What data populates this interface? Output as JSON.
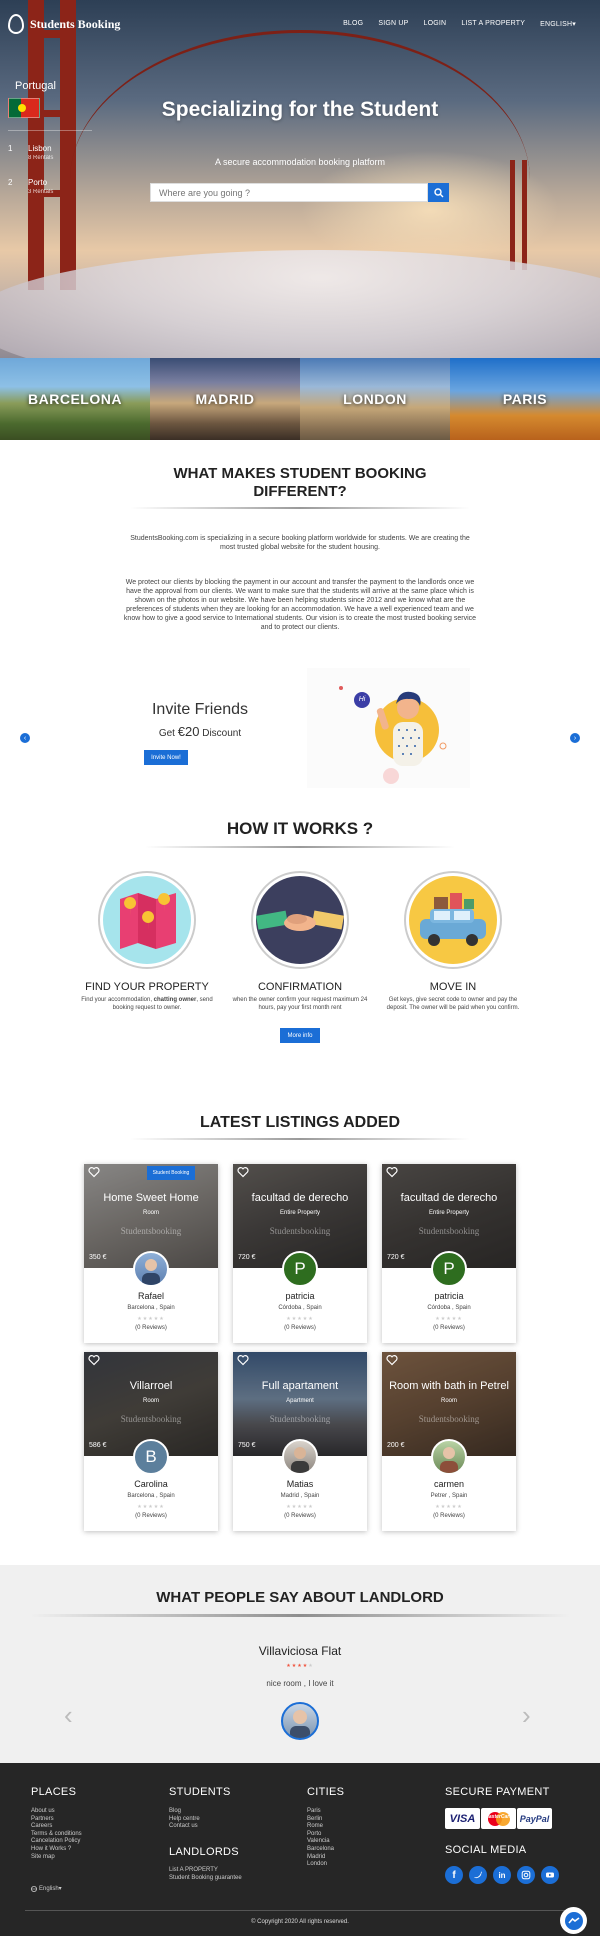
{
  "brand": {
    "name": "Students Booking"
  },
  "nav": {
    "items": [
      "BLOG",
      "SIGN UP",
      "LOGIN",
      "LIST A PROPERTY",
      "ENGLISH▾"
    ]
  },
  "side_panel": {
    "country": "Portugal",
    "cities": [
      {
        "num": "1",
        "name": "Lisbon",
        "count": "8 Rentals"
      },
      {
        "num": "2",
        "name": "Porto",
        "count": "3 Rentals"
      }
    ]
  },
  "hero": {
    "title": "Specializing for the Student",
    "subtitle": "A secure accommodation booking platform",
    "search_placeholder": "Where are you going ?"
  },
  "city_strip": [
    "BARCELONA",
    "MADRID",
    "LONDON",
    "PARIS"
  ],
  "different": {
    "title": "WHAT MAKES STUDENT BOOKING DIFFERENT?",
    "p1": "StudentsBooking.com is specializing in a secure booking platform worldwide for students. We are creating the most trusted global website for the student housing.",
    "p2": "We protect our clients by blocking the payment in our account and transfer the payment to the landlords once we have the approval from our clients. We want to make sure that the students will arrive at the same place which is shown on the photos in our website. We have been helping students since 2012 and we know what are the preferences of students when they are looking for an accommodation. We have a well experienced team and we know how to give a good service to International students. Our vision is to create the most trusted booking service and to protect our clients."
  },
  "invite": {
    "title": "Invite Friends",
    "get": "Get",
    "amount": "€20",
    "discount": "Discount",
    "button": "Invite Now!",
    "bubble": "Hi"
  },
  "how": {
    "title": "HOW IT WORKS ?",
    "steps": [
      {
        "title": "FIND YOUR PROPERTY",
        "text_a": "Find your accommodation, ",
        "text_bold": "chatting owner",
        "text_b": ", send booking request to owner."
      },
      {
        "title": "CONFIRMATION",
        "text": "when the owner confirm your request maximum 24 hours, pay your first month rent"
      },
      {
        "title": "MOVE IN",
        "text": "Get keys, give secret code to owner and pay the deposit. The owner will be paid when you confirm."
      }
    ],
    "button": "More info"
  },
  "listings": {
    "title": "LATEST LISTINGS ADDED",
    "badge": "Student Booking",
    "watermark": "Studentsbooking",
    "items": [
      {
        "title": "Home Sweet Home",
        "type": "Room",
        "price": "350 €",
        "name": "Rafael",
        "location": "Barcelona , Spain",
        "reviews": "(0 Reviews)",
        "stars": "★★★★★"
      },
      {
        "title": "facultad de derecho",
        "type": "Entire Property",
        "price": "720 €",
        "name": "patricia",
        "location": "Córdoba , Spain",
        "reviews": "(0 Reviews)",
        "stars": "★★★★★",
        "initial": "P"
      },
      {
        "title": "facultad de derecho",
        "type": "Entire Property",
        "price": "720 €",
        "name": "patricia",
        "location": "Córdoba , Spain",
        "reviews": "(0 Reviews)",
        "stars": "★★★★★",
        "initial": "P"
      },
      {
        "title": "Villarroel",
        "type": "Room",
        "price": "586 €",
        "name": "Carolina",
        "location": "Barcelona , Spain",
        "reviews": "(0 Reviews)",
        "stars": "★★★★★",
        "initial": "B"
      },
      {
        "title": "Full apartament",
        "type": "Apartment",
        "price": "750 €",
        "name": "Matias",
        "location": "Madrid , Spain",
        "reviews": "(0 Reviews)",
        "stars": "★★★★★"
      },
      {
        "title": "Room with bath in Petrel",
        "type": "Room",
        "price": "200 €",
        "name": "carmen",
        "location": "Petrer , Spain",
        "reviews": "(0 Reviews)",
        "stars": "★★★★★"
      }
    ]
  },
  "testimonials": {
    "title": "WHAT PEOPLE SAY ABOUT LANDLORD",
    "property": "Villaviciosa Flat",
    "stars": "★★★★★",
    "rating": 4,
    "comment": "nice room , I love it",
    "prev": "‹",
    "next": "›"
  },
  "footer": {
    "places": {
      "title": "PLACES",
      "links": [
        "About us",
        "Partners",
        "Careers",
        "Terms & conditions",
        "Cancelation Policy",
        "How it Works ?",
        "Site map"
      ],
      "language": "English▾"
    },
    "students": {
      "title": "STUDENTS",
      "links": [
        "Blog",
        "Help centre",
        "Contact us"
      ]
    },
    "landlords": {
      "title": "LANDLORDS",
      "links": [
        "List A PROPERTY",
        "Student Booking guarantee"
      ]
    },
    "cities": {
      "title": "CITIES",
      "links": [
        "Paris",
        "Berlin",
        "Rome",
        "Porto",
        "Valencia",
        "Barcelona",
        "Madrid",
        "London"
      ]
    },
    "payment": {
      "title": "SECURE PAYMENT",
      "cards": [
        "VISA",
        "MasterCard",
        "PayPal"
      ]
    },
    "social": {
      "title": "SOCIAL MEDIA",
      "icons": [
        "facebook-icon",
        "twitter-icon",
        "linkedin-icon",
        "instagram-icon",
        "youtube-icon"
      ]
    },
    "copyright": "© Copyright 2020 All rights reserved."
  },
  "colors": {
    "accent": "#1b6ed6",
    "footer_bg": "#262626",
    "testimonial_bg": "#f0f0f0"
  }
}
